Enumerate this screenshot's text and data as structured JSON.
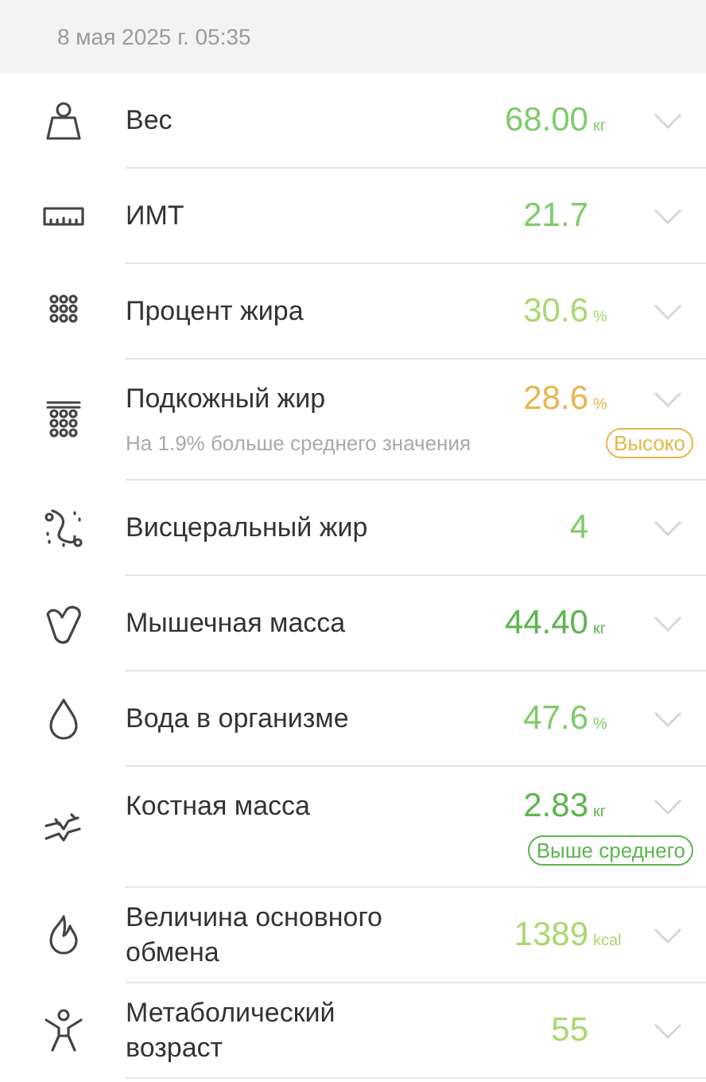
{
  "header": {
    "date": "8 мая 2025 г. 05:35"
  },
  "metrics": [
    {
      "kind": "weight",
      "name": "Вес",
      "value": "68.00",
      "unit": "кг",
      "color": "#7fcb6c"
    },
    {
      "kind": "bmi",
      "name": "ИМТ",
      "value": "21.7",
      "color": "#7fcb6c"
    },
    {
      "kind": "fat",
      "name": "Процент жира",
      "value": "30.6",
      "unit": "%",
      "color": "#a9d870"
    },
    {
      "kind": "subcutaneous",
      "name": "Подкожный жир",
      "value": "28.6",
      "unit": "%",
      "color": "#e8b64c",
      "note": "На 1.9% больше среднего значения",
      "badge": "Высоко"
    },
    {
      "kind": "visceral",
      "name": "Висцеральный жир",
      "value": "4",
      "color": "#7fcb6c"
    },
    {
      "kind": "muscle",
      "name": "Мышечная масса",
      "value": "44.40",
      "unit": "кг",
      "color": "#5cb54e"
    },
    {
      "kind": "water",
      "name": "Вода в организме",
      "value": "47.6",
      "unit": "%",
      "color": "#7fcb6c"
    },
    {
      "kind": "bone",
      "name": "Костная масса",
      "value": "2.83",
      "unit": "кг",
      "color": "#5cb54e",
      "badge": "Выше среднего"
    },
    {
      "kind": "bmr",
      "name": "Величина основного обмена",
      "value": "1389",
      "unit": "kcal",
      "color": "#a9d870"
    },
    {
      "kind": "age",
      "name": "Метаболический возраст",
      "value": "55",
      "color": "#a9d870"
    }
  ]
}
